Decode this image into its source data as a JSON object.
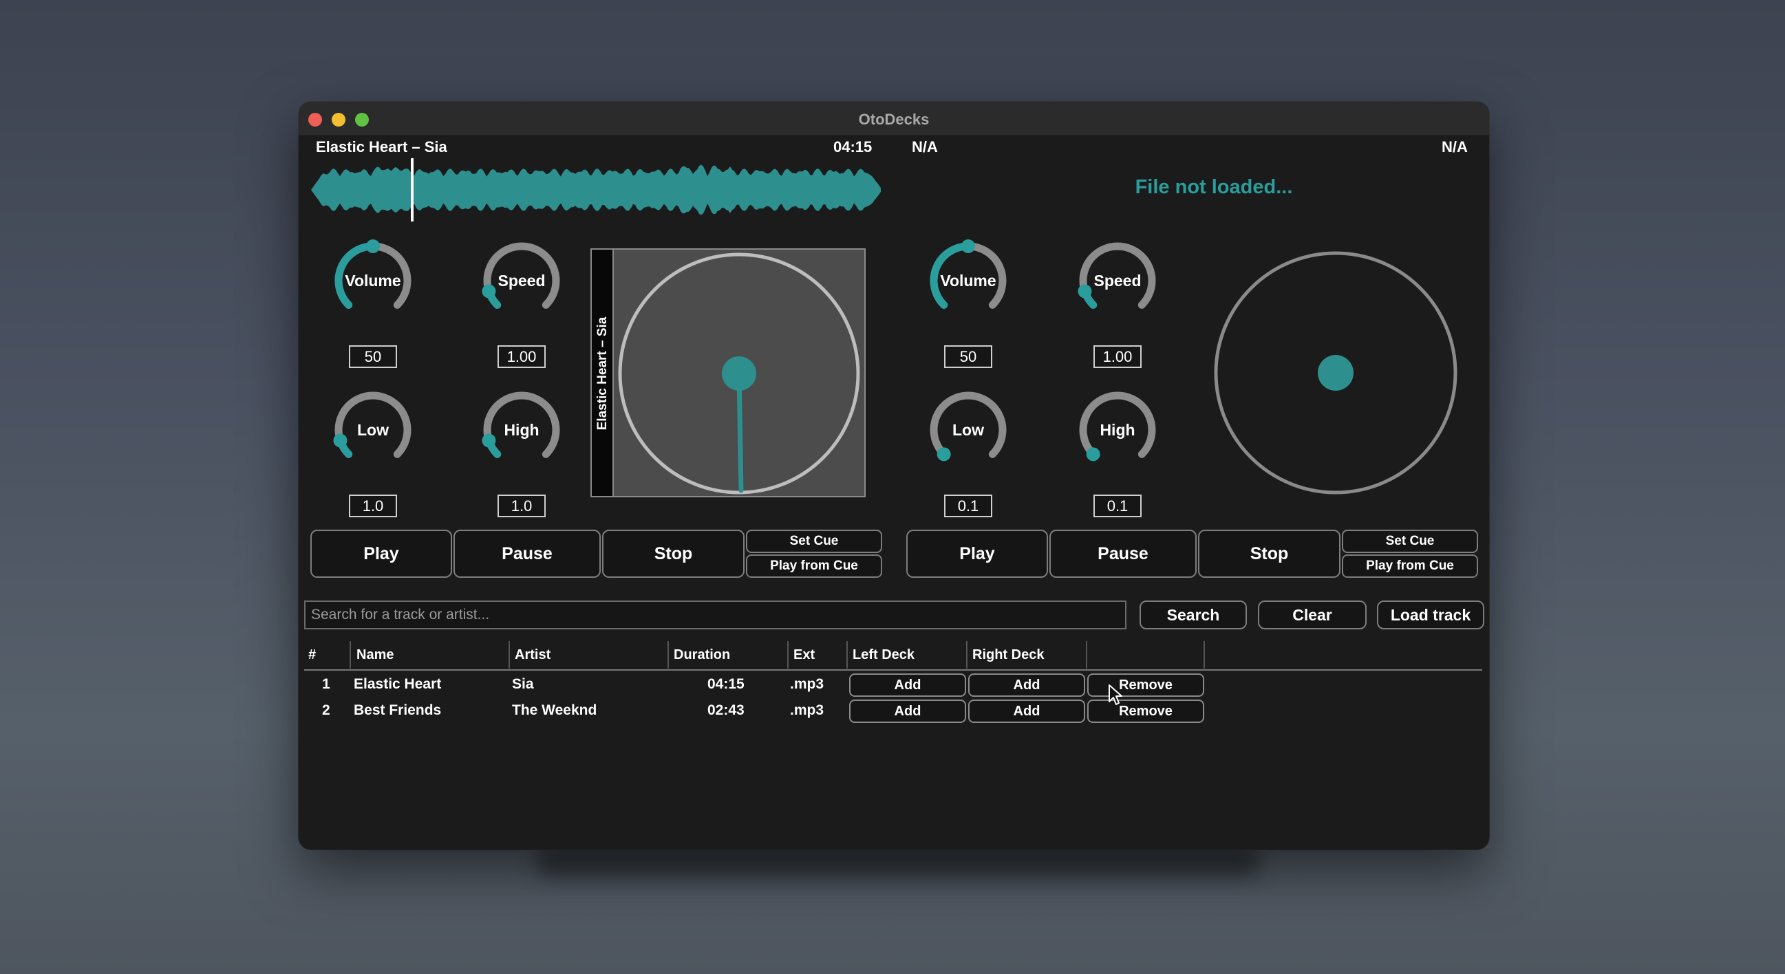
{
  "window": {
    "title": "OtoDecks"
  },
  "colors": {
    "accent": "#2a9d9d",
    "knob_track": "#8c8c8c",
    "background": "#1b1b1b"
  },
  "left_deck": {
    "track_name": "Elastic Heart – Sia",
    "duration": "04:15",
    "knobs": {
      "volume": {
        "label": "Volume",
        "value": "50",
        "level": 0.5
      },
      "speed": {
        "label": "Speed",
        "value": "1.00",
        "level": 0.1
      },
      "low": {
        "label": "Low",
        "value": "1.0",
        "level": 0.1
      },
      "high": {
        "label": "High",
        "value": "1.0",
        "level": 0.1
      }
    },
    "disc_label": "Elastic Heart – Sia",
    "buttons": {
      "play": "Play",
      "pause": "Pause",
      "stop": "Stop",
      "set_cue": "Set Cue",
      "play_from_cue": "Play from Cue"
    }
  },
  "right_deck": {
    "track_name": "N/A",
    "duration": "N/A",
    "status": "File not loaded...",
    "knobs": {
      "volume": {
        "label": "Volume",
        "value": "50",
        "level": 0.5
      },
      "speed": {
        "label": "Speed",
        "value": "1.00",
        "level": 0.1
      },
      "low": {
        "label": "Low",
        "value": "0.1",
        "level": 0.0
      },
      "high": {
        "label": "High",
        "value": "0.1",
        "level": 0.0
      }
    },
    "buttons": {
      "play": "Play",
      "pause": "Pause",
      "stop": "Stop",
      "set_cue": "Set Cue",
      "play_from_cue": "Play from Cue"
    }
  },
  "library": {
    "search_placeholder": "Search for a track or artist...",
    "search_button": "Search",
    "clear_button": "Clear",
    "load_button": "Load track",
    "columns": [
      "#",
      "Name",
      "Artist",
      "Duration",
      "Ext",
      "Left Deck",
      "Right Deck"
    ],
    "rows": [
      {
        "num": "1",
        "name": "Elastic Heart",
        "artist": "Sia",
        "duration": "04:15",
        "ext": ".mp3",
        "left": "Add",
        "right": "Add",
        "remove": "Remove"
      },
      {
        "num": "2",
        "name": "Best Friends",
        "artist": "The Weeknd",
        "duration": "02:43",
        "ext": ".mp3",
        "left": "Add",
        "right": "Add",
        "remove": "Remove"
      }
    ]
  }
}
